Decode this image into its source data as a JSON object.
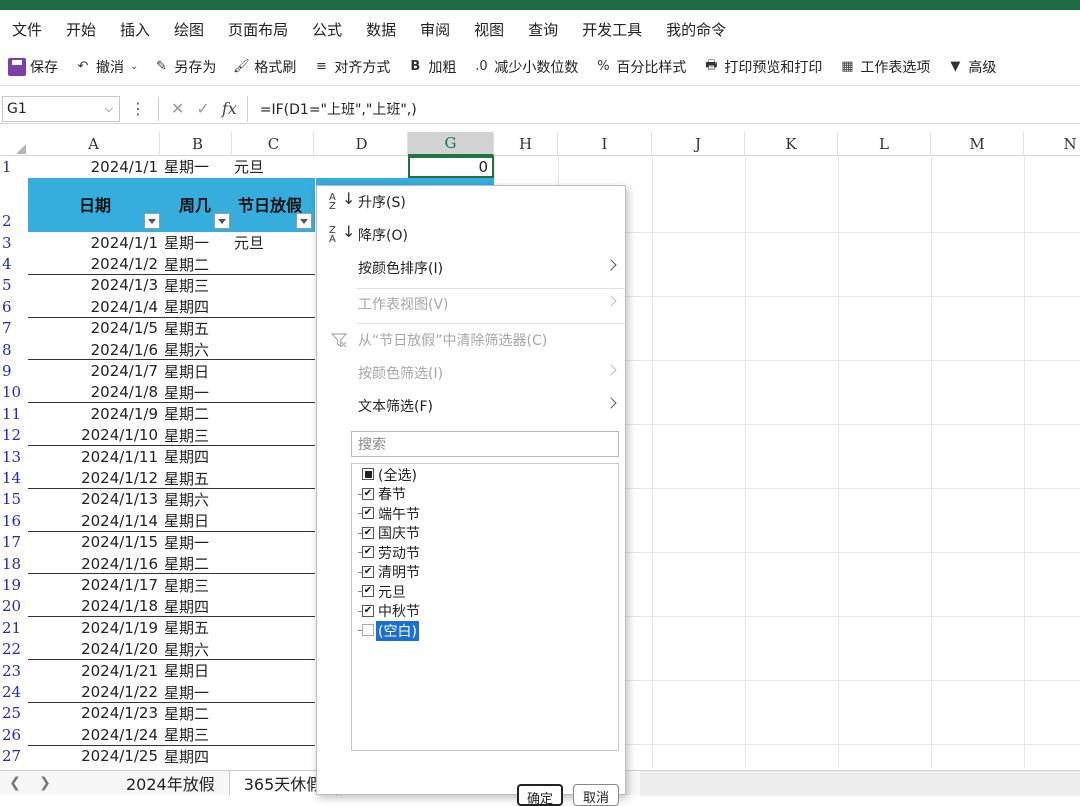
{
  "ribbon": {
    "tabs": [
      "文件",
      "开始",
      "插入",
      "绘图",
      "页面布局",
      "公式",
      "数据",
      "审阅",
      "视图",
      "查询",
      "开发工具",
      "我的命令"
    ]
  },
  "toolbar": {
    "buttons": [
      {
        "label": "保存",
        "icon": "save-icon"
      },
      {
        "label": "撤消",
        "icon": "undo-icon"
      },
      {
        "label": "另存为",
        "icon": "save-as-icon"
      },
      {
        "label": "格式刷",
        "icon": "format-painter-icon"
      },
      {
        "label": "对齐方式",
        "icon": "align-icon"
      },
      {
        "label": "加粗",
        "icon": "bold-icon"
      },
      {
        "label": "减少小数位数",
        "icon": "decrease-decimal-icon"
      },
      {
        "label": "百分比样式",
        "icon": "percent-icon"
      },
      {
        "label": "打印预览和打印",
        "icon": "print-preview-icon"
      },
      {
        "label": "工作表选项",
        "icon": "sheet-options-icon"
      },
      {
        "label": "高级",
        "icon": "advanced-filter-icon"
      }
    ]
  },
  "formula_bar": {
    "name_box": "G1",
    "fx": "fx",
    "formula": "=IF(D1=\"上班\",\"上班\",)"
  },
  "grid": {
    "columns": [
      "A",
      "B",
      "C",
      "D",
      "G",
      "H",
      "I",
      "J",
      "K",
      "L",
      "M",
      "N"
    ],
    "selected_column": "G",
    "row1": {
      "num": "1",
      "date": "2024/1/1",
      "week": "星期一",
      "holiday": "元旦",
      "g_value": "0"
    },
    "header_row_num": "2",
    "headers": {
      "date": "日期",
      "week": "周几",
      "holiday": "节日放假"
    },
    "rows": [
      {
        "num": "3",
        "date": "2024/1/1",
        "week": "星期一",
        "holiday": "元旦"
      },
      {
        "num": "4",
        "date": "2024/1/2",
        "week": "星期二",
        "holiday": ""
      },
      {
        "num": "5",
        "date": "2024/1/3",
        "week": "星期三",
        "holiday": ""
      },
      {
        "num": "6",
        "date": "2024/1/4",
        "week": "星期四",
        "holiday": ""
      },
      {
        "num": "7",
        "date": "2024/1/5",
        "week": "星期五",
        "holiday": ""
      },
      {
        "num": "8",
        "date": "2024/1/6",
        "week": "星期六",
        "holiday": ""
      },
      {
        "num": "9",
        "date": "2024/1/7",
        "week": "星期日",
        "holiday": ""
      },
      {
        "num": "10",
        "date": "2024/1/8",
        "week": "星期一",
        "holiday": ""
      },
      {
        "num": "11",
        "date": "2024/1/9",
        "week": "星期二",
        "holiday": ""
      },
      {
        "num": "12",
        "date": "2024/1/10",
        "week": "星期三",
        "holiday": ""
      },
      {
        "num": "13",
        "date": "2024/1/11",
        "week": "星期四",
        "holiday": ""
      },
      {
        "num": "14",
        "date": "2024/1/12",
        "week": "星期五",
        "holiday": ""
      },
      {
        "num": "15",
        "date": "2024/1/13",
        "week": "星期六",
        "holiday": ""
      },
      {
        "num": "16",
        "date": "2024/1/14",
        "week": "星期日",
        "holiday": ""
      },
      {
        "num": "17",
        "date": "2024/1/15",
        "week": "星期一",
        "holiday": ""
      },
      {
        "num": "18",
        "date": "2024/1/16",
        "week": "星期二",
        "holiday": ""
      },
      {
        "num": "19",
        "date": "2024/1/17",
        "week": "星期三",
        "holiday": ""
      },
      {
        "num": "20",
        "date": "2024/1/18",
        "week": "星期四",
        "holiday": ""
      },
      {
        "num": "21",
        "date": "2024/1/19",
        "week": "星期五",
        "holiday": ""
      },
      {
        "num": "22",
        "date": "2024/1/20",
        "week": "星期六",
        "holiday": ""
      },
      {
        "num": "23",
        "date": "2024/1/21",
        "week": "星期日",
        "holiday": ""
      },
      {
        "num": "24",
        "date": "2024/1/22",
        "week": "星期一",
        "holiday": ""
      },
      {
        "num": "25",
        "date": "2024/1/23",
        "week": "星期二",
        "holiday": ""
      },
      {
        "num": "26",
        "date": "2024/1/24",
        "week": "星期三",
        "holiday": ""
      },
      {
        "num": "27",
        "date": "2024/1/25",
        "week": "星期四",
        "holiday": ""
      }
    ]
  },
  "sheets": {
    "tabs": [
      "2024年放假",
      "365天休假"
    ],
    "active": 0
  },
  "filter_menu": {
    "sort_asc": "升序(S)",
    "sort_desc": "降序(O)",
    "sort_by_color": "按颜色排序(I)",
    "sheet_view": "工作表视图(V)",
    "clear_filter": "从“节日放假”中清除筛选器(C)",
    "filter_by_color": "按颜色筛选(I)",
    "text_filter": "文本筛选(F)",
    "search_placeholder": "搜索",
    "options": [
      {
        "label": "(全选)",
        "state": "partial"
      },
      {
        "label": "春节",
        "state": "checked"
      },
      {
        "label": "端午节",
        "state": "checked"
      },
      {
        "label": "国庆节",
        "state": "checked"
      },
      {
        "label": "劳动节",
        "state": "checked"
      },
      {
        "label": "清明节",
        "state": "checked"
      },
      {
        "label": "元旦",
        "state": "checked"
      },
      {
        "label": "中秋节",
        "state": "checked"
      },
      {
        "label": "(空白)",
        "state": "unchecked",
        "highlighted": true
      }
    ],
    "ok_label": "确定",
    "cancel_label": "取消"
  },
  "colors": {
    "header_fill": "#35aede",
    "selection": "#1f7244",
    "row_number": "#2828b0",
    "highlight": "#1a6fd1"
  }
}
